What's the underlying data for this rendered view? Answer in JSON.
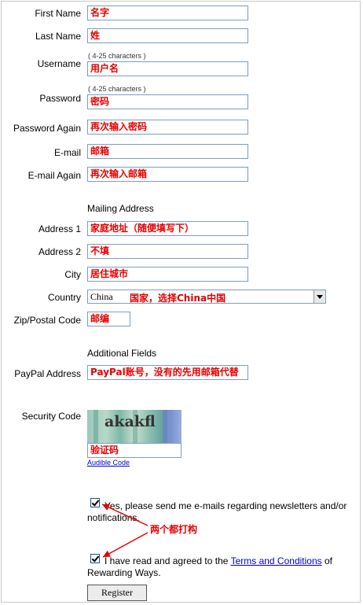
{
  "form": {
    "first_name": {
      "label": "First Name",
      "value": "名字"
    },
    "last_name": {
      "label": "Last Name",
      "value": "姓"
    },
    "username": {
      "label": "Username",
      "hint": "( 4-25 characters )",
      "value": "用户名"
    },
    "password": {
      "label": "Password",
      "hint": "( 4-25 characters )",
      "value": "密码"
    },
    "password_again": {
      "label": "Password Again",
      "value": "再次输入密码"
    },
    "email": {
      "label": "E-mail",
      "value": "邮箱"
    },
    "email_again": {
      "label": "E-mail Again",
      "value": "再次输入邮箱"
    },
    "mailing_section": "Mailing Address",
    "address1": {
      "label": "Address 1",
      "value": "家庭地址（随便填写下）"
    },
    "address2": {
      "label": "Address 2",
      "value": "不填"
    },
    "city": {
      "label": "City",
      "value": "居住城市"
    },
    "country": {
      "label": "Country",
      "selected": "China",
      "annotation": "国家，选择China中国"
    },
    "zip": {
      "label": "Zip/Postal Code",
      "value": "邮编"
    },
    "additional_section": "Additional Fields",
    "paypal": {
      "label": "PayPal Address",
      "value": "PayPal账号，没有的先用邮箱代替"
    },
    "security": {
      "label": "Security Code",
      "captcha_text": "akakfl",
      "value": "验证码",
      "audio_link": "Audible Code"
    },
    "newsletter": {
      "text": "Yes, please send me e-mails regarding newsletters and/or notifications.",
      "checked": true
    },
    "terms": {
      "prefix": "I have read and agreed to the ",
      "link": "Terms and Conditions",
      "suffix": " of Rewarding Ways.",
      "checked": true
    },
    "check_note": "两个都打构",
    "register_label": "Register"
  },
  "colors": {
    "annotation": "#e60000",
    "link": "#0000cc",
    "input_border": "#7f9db9"
  }
}
